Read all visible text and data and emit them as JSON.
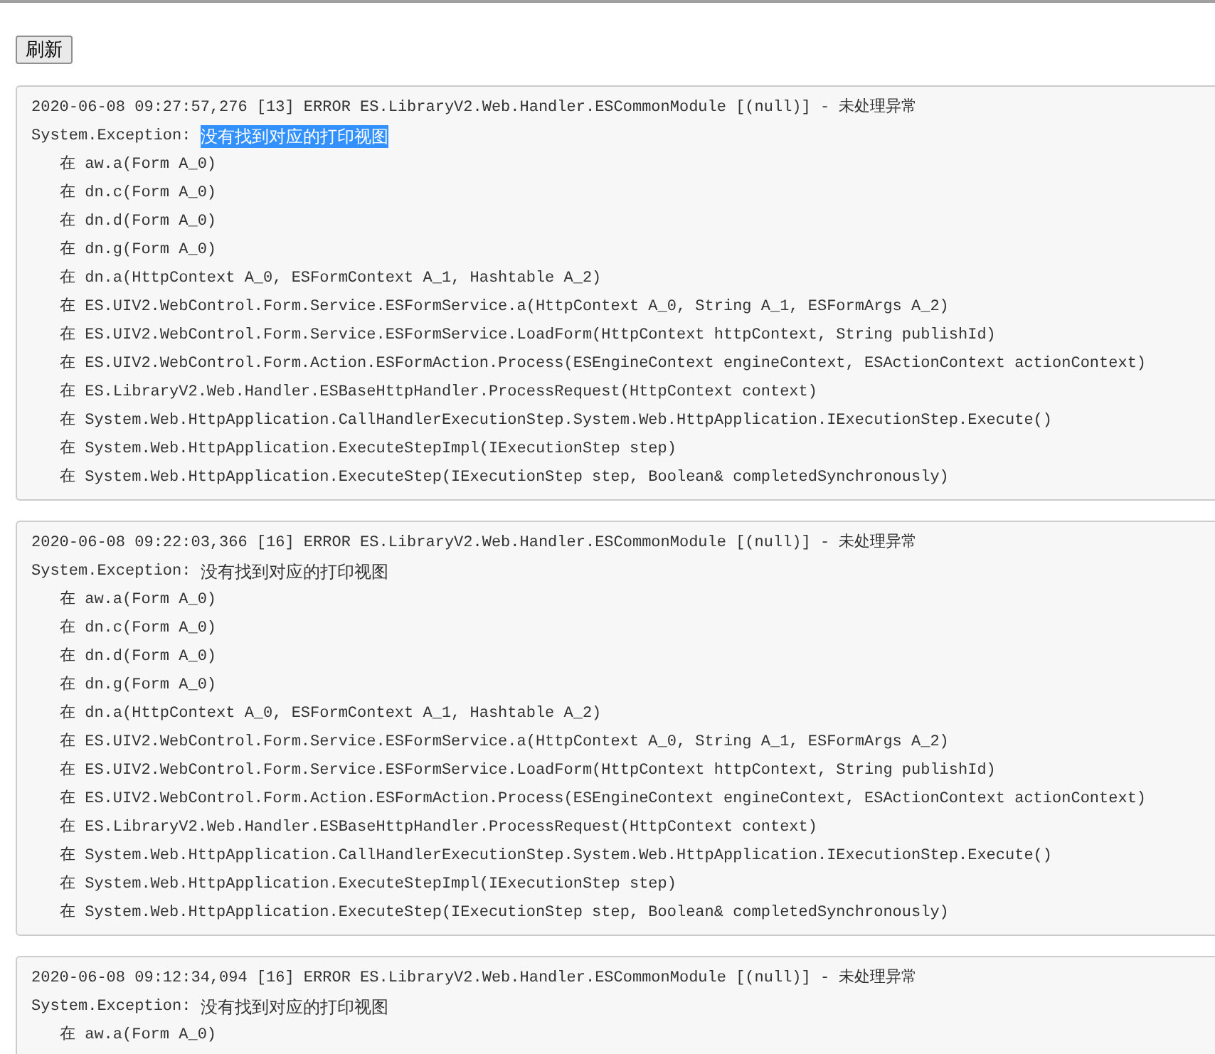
{
  "refresh_button": {
    "label": "刷新"
  },
  "log_entries": [
    {
      "header": "2020-06-08 09:27:57,276 [13] ERROR ES.LibraryV2.Web.Handler.ESCommonModule [(null)] - 未处理异常",
      "exception_type": "System.Exception: ",
      "message": "没有找到对应的打印视图",
      "message_selected": true,
      "frames": [
        "在 aw.a(Form A_0)",
        "在 dn.c(Form A_0)",
        "在 dn.d(Form A_0)",
        "在 dn.g(Form A_0)",
        "在 dn.a(HttpContext A_0, ESFormContext A_1, Hashtable A_2)",
        "在 ES.UIV2.WebControl.Form.Service.ESFormService.a(HttpContext A_0, String A_1, ESFormArgs A_2)",
        "在 ES.UIV2.WebControl.Form.Service.ESFormService.LoadForm(HttpContext httpContext, String publishId)",
        "在 ES.UIV2.WebControl.Form.Action.ESFormAction.Process(ESEngineContext engineContext, ESActionContext actionContext)",
        "在 ES.LibraryV2.Web.Handler.ESBaseHttpHandler.ProcessRequest(HttpContext context)",
        "在 System.Web.HttpApplication.CallHandlerExecutionStep.System.Web.HttpApplication.IExecutionStep.Execute()",
        "在 System.Web.HttpApplication.ExecuteStepImpl(IExecutionStep step)",
        "在 System.Web.HttpApplication.ExecuteStep(IExecutionStep step, Boolean& completedSynchronously)"
      ]
    },
    {
      "header": "2020-06-08 09:22:03,366 [16] ERROR ES.LibraryV2.Web.Handler.ESCommonModule [(null)] - 未处理异常",
      "exception_type": "System.Exception: ",
      "message": "没有找到对应的打印视图",
      "message_selected": false,
      "frames": [
        "在 aw.a(Form A_0)",
        "在 dn.c(Form A_0)",
        "在 dn.d(Form A_0)",
        "在 dn.g(Form A_0)",
        "在 dn.a(HttpContext A_0, ESFormContext A_1, Hashtable A_2)",
        "在 ES.UIV2.WebControl.Form.Service.ESFormService.a(HttpContext A_0, String A_1, ESFormArgs A_2)",
        "在 ES.UIV2.WebControl.Form.Service.ESFormService.LoadForm(HttpContext httpContext, String publishId)",
        "在 ES.UIV2.WebControl.Form.Action.ESFormAction.Process(ESEngineContext engineContext, ESActionContext actionContext)",
        "在 ES.LibraryV2.Web.Handler.ESBaseHttpHandler.ProcessRequest(HttpContext context)",
        "在 System.Web.HttpApplication.CallHandlerExecutionStep.System.Web.HttpApplication.IExecutionStep.Execute()",
        "在 System.Web.HttpApplication.ExecuteStepImpl(IExecutionStep step)",
        "在 System.Web.HttpApplication.ExecuteStep(IExecutionStep step, Boolean& completedSynchronously)"
      ]
    },
    {
      "header": "2020-06-08 09:12:34,094 [16] ERROR ES.LibraryV2.Web.Handler.ESCommonModule [(null)] - 未处理异常",
      "exception_type": "System.Exception: ",
      "message": "没有找到对应的打印视图",
      "message_selected": false,
      "frames": [
        "在 aw.a(Form A_0)"
      ]
    }
  ]
}
